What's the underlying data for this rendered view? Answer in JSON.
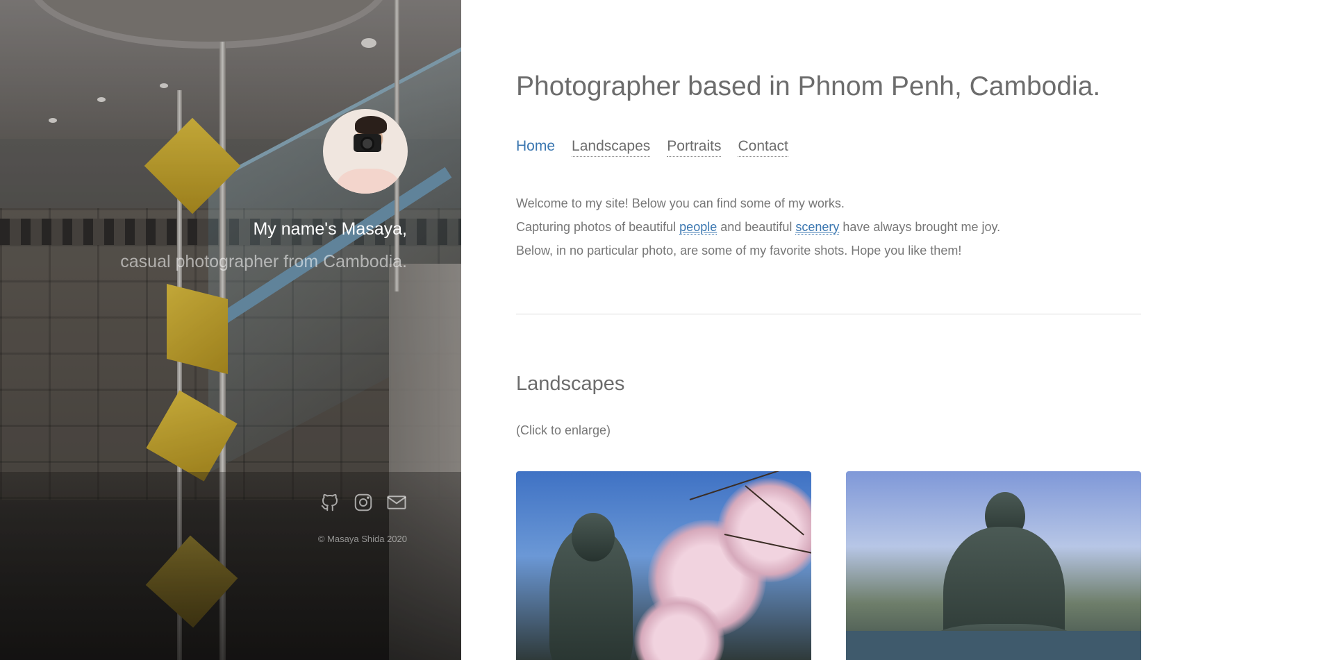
{
  "sidebar": {
    "name_line": "My name's Masaya,",
    "tagline": "casual photographer from Cambodia.",
    "social": [
      {
        "icon": "github-icon"
      },
      {
        "icon": "instagram-icon"
      },
      {
        "icon": "mail-icon"
      }
    ],
    "copyright": "© Masaya Shida 2020"
  },
  "main": {
    "title": "Photographer based in Phnom Penh, Cambodia.",
    "nav": [
      {
        "label": "Home",
        "active": true
      },
      {
        "label": "Landscapes",
        "active": false
      },
      {
        "label": "Portraits",
        "active": false
      },
      {
        "label": "Contact",
        "active": false
      }
    ],
    "intro": {
      "line1": "Welcome to my site! Below you can find some of my works.",
      "line2_a": "Capturing photos of beautiful ",
      "line2_link1": "people",
      "line2_b": " and beautiful ",
      "line2_link2": "scenery",
      "line2_c": " have always brought me joy.",
      "line3": "Below, in no particular photo, are some of my favorite shots. Hope you like them!"
    },
    "section": {
      "title": "Landscapes",
      "hint": "(Click to enlarge)"
    }
  },
  "colors": {
    "link": "#3a76b0",
    "text": "#6c6c6c"
  }
}
